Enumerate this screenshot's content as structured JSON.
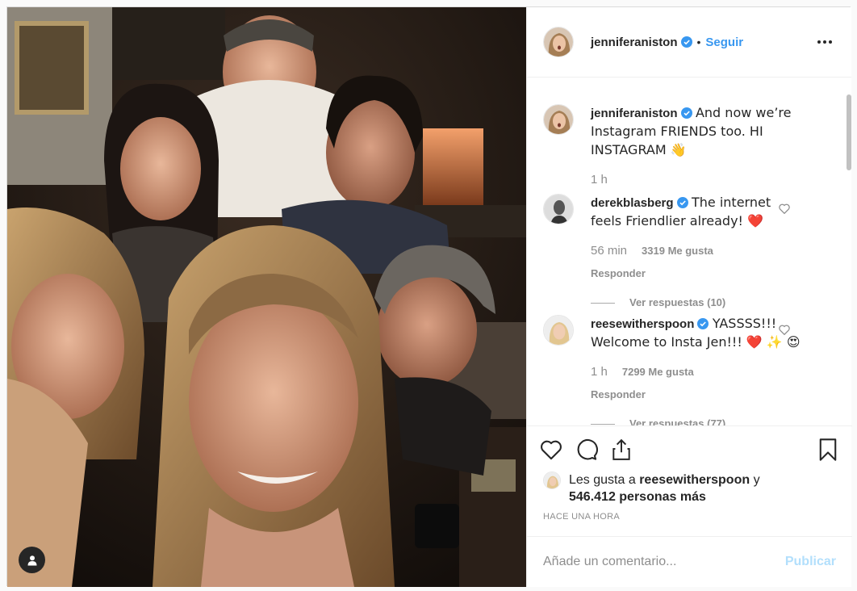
{
  "post": {
    "author": "jenniferaniston",
    "separator": "•",
    "follow_label": "Seguir"
  },
  "caption": {
    "username": "jenniferaniston",
    "text": "And now we’re Instagram FRIENDS too. HI INSTAGRAM 👋",
    "time": "1 h"
  },
  "comments": [
    {
      "username": "derekblasberg",
      "verified": true,
      "text": "The internet feels Friendlier already! ❤️",
      "time": "56 min",
      "likes": "3319 Me gusta",
      "reply_label": "Responder",
      "view_replies": "Ver respuestas (10)"
    },
    {
      "username": "reesewitherspoon",
      "verified": true,
      "text": "YASSSS!!! Welcome to Insta Jen!!! ❤️ ✨ 😍",
      "time": "1 h",
      "likes": "7299 Me gusta",
      "reply_label": "Responder",
      "view_replies": "Ver respuestas (77)"
    }
  ],
  "likes": {
    "prefix": "Les gusta a",
    "user": "reesewitherspoon",
    "joiner": "y",
    "others": "546.412 personas más"
  },
  "timestamp": "HACE UNA HORA",
  "comment_box": {
    "placeholder": "Añade un comentario...",
    "publish_label": "Publicar"
  },
  "icons": {
    "like": "heart-icon",
    "comment": "comment-icon",
    "share": "share-icon",
    "save": "bookmark-icon",
    "more": "more-options-icon",
    "tagged": "user-tag-icon",
    "verified": "verified-badge-icon"
  },
  "colors": {
    "accent": "#3897f0",
    "publish_disabled": "#b2dffc",
    "secondary_text": "#8e8e8e"
  }
}
